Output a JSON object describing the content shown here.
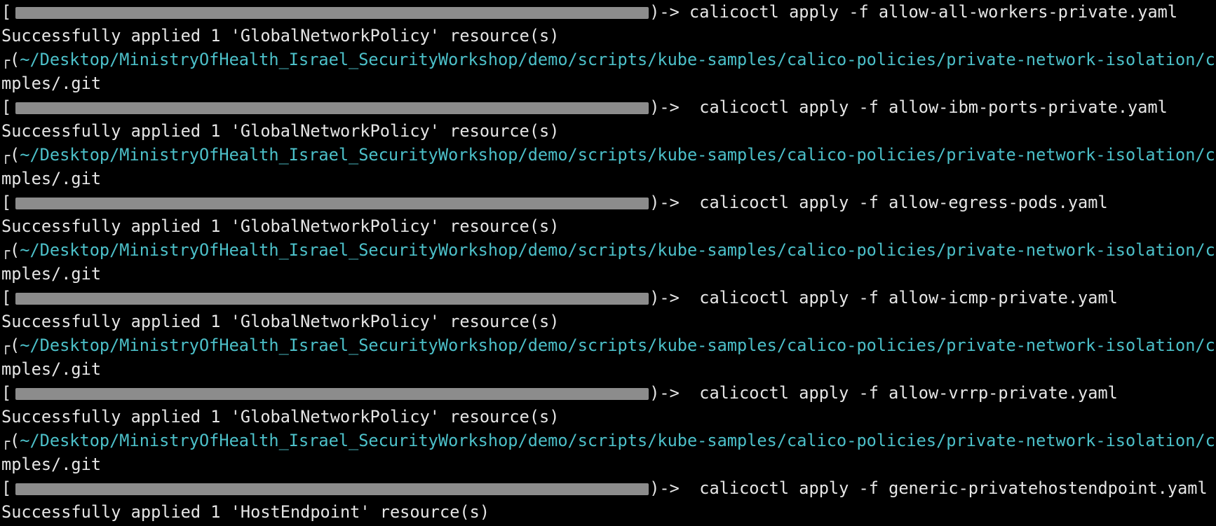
{
  "terminal": {
    "blocks": [
      {
        "prompt": {
          "open": "[",
          "arrow": ")->",
          "command": " calicoctl apply -f allow-all-workers-private.yaml"
        },
        "output": "Successfully applied 1 'GlobalNetworkPolicy' resource(s)",
        "path_corner": "┌",
        "path_paren": "(",
        "path": "~/Desktop/MinistryOfHealth_Israel_SecurityWorkshop/demo/scripts/kube-samples/calico-policies/private-network-isolation/cal",
        "git": "mples/.git"
      },
      {
        "prompt": {
          "open": "[",
          "arrow": ")->",
          "command": "  calicoctl apply -f allow-ibm-ports-private.yaml"
        },
        "output": "Successfully applied 1 'GlobalNetworkPolicy' resource(s)",
        "path_corner": "┌",
        "path_paren": "(",
        "path": "~/Desktop/MinistryOfHealth_Israel_SecurityWorkshop/demo/scripts/kube-samples/calico-policies/private-network-isolation/cal",
        "git": "mples/.git"
      },
      {
        "prompt": {
          "open": "[",
          "arrow": ")->",
          "command": "  calicoctl apply -f allow-egress-pods.yaml"
        },
        "output": "Successfully applied 1 'GlobalNetworkPolicy' resource(s)",
        "path_corner": "┌",
        "path_paren": "(",
        "path": "~/Desktop/MinistryOfHealth_Israel_SecurityWorkshop/demo/scripts/kube-samples/calico-policies/private-network-isolation/cal",
        "git": "mples/.git"
      },
      {
        "prompt": {
          "open": "[",
          "arrow": ")->",
          "command": "  calicoctl apply -f allow-icmp-private.yaml"
        },
        "output": "Successfully applied 1 'GlobalNetworkPolicy' resource(s)",
        "path_corner": "┌",
        "path_paren": "(",
        "path": "~/Desktop/MinistryOfHealth_Israel_SecurityWorkshop/demo/scripts/kube-samples/calico-policies/private-network-isolation/cal",
        "git": "mples/.git"
      },
      {
        "prompt": {
          "open": "[",
          "arrow": ")->",
          "command": "  calicoctl apply -f allow-vrrp-private.yaml"
        },
        "output": "Successfully applied 1 'GlobalNetworkPolicy' resource(s)",
        "path_corner": "┌",
        "path_paren": "(",
        "path": "~/Desktop/MinistryOfHealth_Israel_SecurityWorkshop/demo/scripts/kube-samples/calico-policies/private-network-isolation/cal",
        "git": "mples/.git"
      },
      {
        "prompt": {
          "open": "[",
          "arrow": ")->",
          "command": "  calicoctl apply -f generic-privatehostendpoint.yaml"
        },
        "output": "Successfully applied 1 'HostEndpoint' resource(s)"
      }
    ],
    "colors": {
      "background": "#000000",
      "foreground": "#e6e6e6",
      "path": "#4cc0c9",
      "redaction": "#8c8c8c"
    }
  }
}
